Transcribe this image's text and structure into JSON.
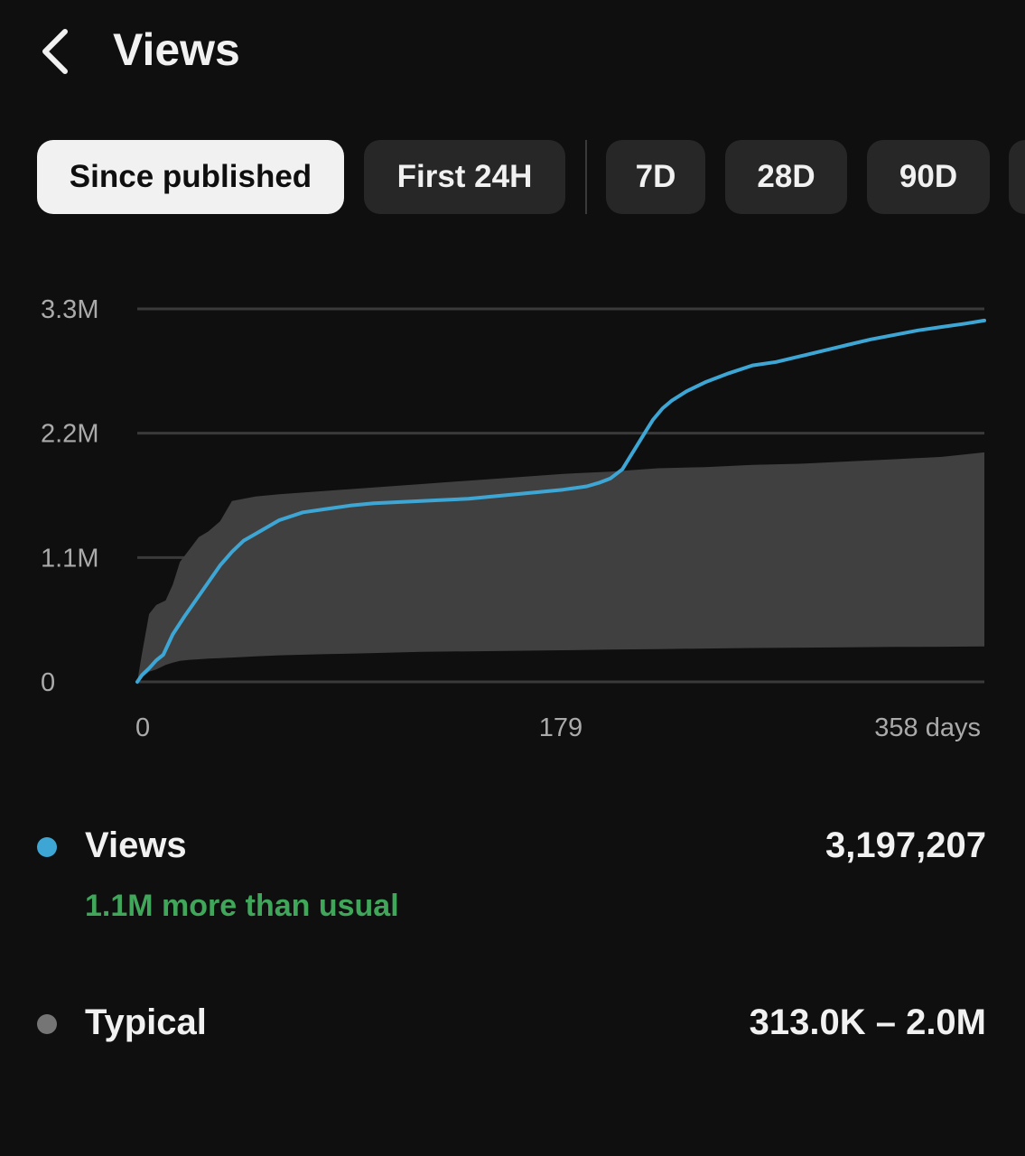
{
  "header": {
    "title": "Views"
  },
  "filters": {
    "chips": [
      {
        "label": "Since published",
        "active": true
      },
      {
        "label": "First 24H",
        "active": false
      },
      {
        "label": "7D",
        "active": false
      },
      {
        "label": "28D",
        "active": false
      },
      {
        "label": "90D",
        "active": false
      }
    ]
  },
  "colors": {
    "background": "#0f0f0f",
    "views_line": "#3ea6d5",
    "typical_band": "#404040",
    "typical_dot": "#757575",
    "positive_text": "#3fa65a",
    "grid": "#3a3a3a",
    "axis_text": "#aaaaaa"
  },
  "chart_data": {
    "type": "line",
    "x_unit": "days",
    "xlim": [
      0,
      358
    ],
    "ylim": [
      0,
      3300000
    ],
    "x_ticks": [
      {
        "value": 0,
        "label": "0"
      },
      {
        "value": 179,
        "label": "179"
      },
      {
        "value": 358,
        "label": "358 days"
      }
    ],
    "y_ticks": [
      {
        "value": 0,
        "label": "0"
      },
      {
        "value": 1100000,
        "label": "1.1M"
      },
      {
        "value": 2200000,
        "label": "2.2M"
      },
      {
        "value": 3300000,
        "label": "3.3M"
      }
    ],
    "grid": true,
    "series": [
      {
        "name": "Views",
        "x": [
          0,
          2,
          5,
          8,
          11,
          15,
          20,
          25,
          30,
          35,
          40,
          45,
          50,
          60,
          70,
          80,
          90,
          100,
          110,
          120,
          130,
          140,
          150,
          160,
          170,
          180,
          190,
          195,
          200,
          205,
          210,
          215,
          218,
          222,
          226,
          232,
          240,
          250,
          260,
          270,
          280,
          290,
          300,
          310,
          320,
          330,
          340,
          350,
          358
        ],
        "y": [
          0,
          60000,
          120000,
          190000,
          240000,
          420000,
          580000,
          730000,
          880000,
          1030000,
          1150000,
          1250000,
          1310000,
          1430000,
          1500000,
          1530000,
          1560000,
          1580000,
          1590000,
          1600000,
          1610000,
          1620000,
          1640000,
          1660000,
          1680000,
          1700000,
          1730000,
          1760000,
          1800000,
          1880000,
          2050000,
          2220000,
          2320000,
          2420000,
          2490000,
          2570000,
          2650000,
          2730000,
          2800000,
          2830000,
          2880000,
          2930000,
          2980000,
          3030000,
          3070000,
          3110000,
          3140000,
          3170000,
          3197207
        ]
      },
      {
        "name": "Typical",
        "x": [
          0,
          2,
          5,
          8,
          12,
          15,
          18,
          22,
          26,
          30,
          35,
          40,
          50,
          60,
          80,
          100,
          120,
          140,
          160,
          180,
          200,
          220,
          240,
          260,
          280,
          300,
          320,
          340,
          358
        ],
        "upper": [
          0,
          250000,
          600000,
          680000,
          720000,
          860000,
          1060000,
          1170000,
          1280000,
          1330000,
          1420000,
          1600000,
          1640000,
          1660000,
          1690000,
          1720000,
          1750000,
          1780000,
          1810000,
          1840000,
          1860000,
          1890000,
          1900000,
          1920000,
          1930000,
          1950000,
          1970000,
          1990000,
          2030000
        ],
        "lower": [
          0,
          40000,
          90000,
          110000,
          150000,
          170000,
          185000,
          195000,
          200000,
          205000,
          210000,
          215000,
          225000,
          235000,
          245000,
          255000,
          265000,
          270000,
          275000,
          280000,
          285000,
          290000,
          295000,
          300000,
          303000,
          306000,
          309000,
          311000,
          313000
        ]
      }
    ]
  },
  "legend": {
    "views": {
      "label": "Views",
      "value": "3,197,207",
      "note": "1.1M more than usual"
    },
    "typical": {
      "label": "Typical",
      "value": "313.0K – 2.0M"
    }
  }
}
